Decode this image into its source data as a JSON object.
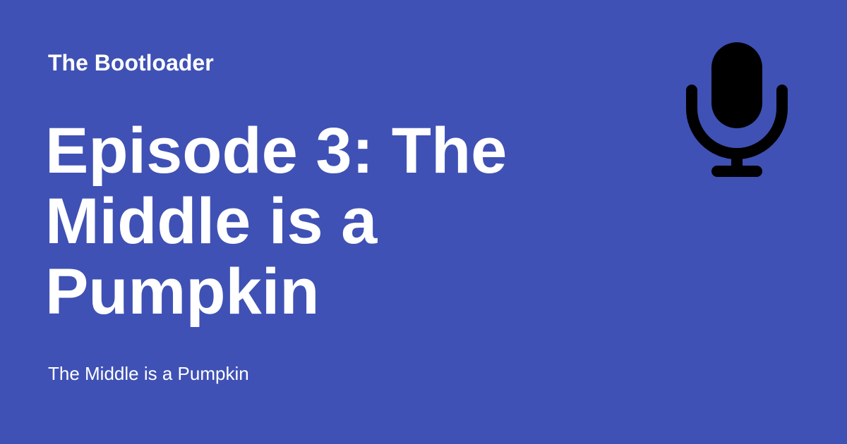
{
  "show": {
    "name": "The Bootloader"
  },
  "episode": {
    "title": "Episode 3: The Middle is a Pumpkin",
    "subtitle": "The Middle is a Pumpkin"
  },
  "icon": {
    "name": "microphone-icon",
    "color": "#000000"
  },
  "colors": {
    "background": "#3f51b5",
    "text": "#ffffff"
  }
}
